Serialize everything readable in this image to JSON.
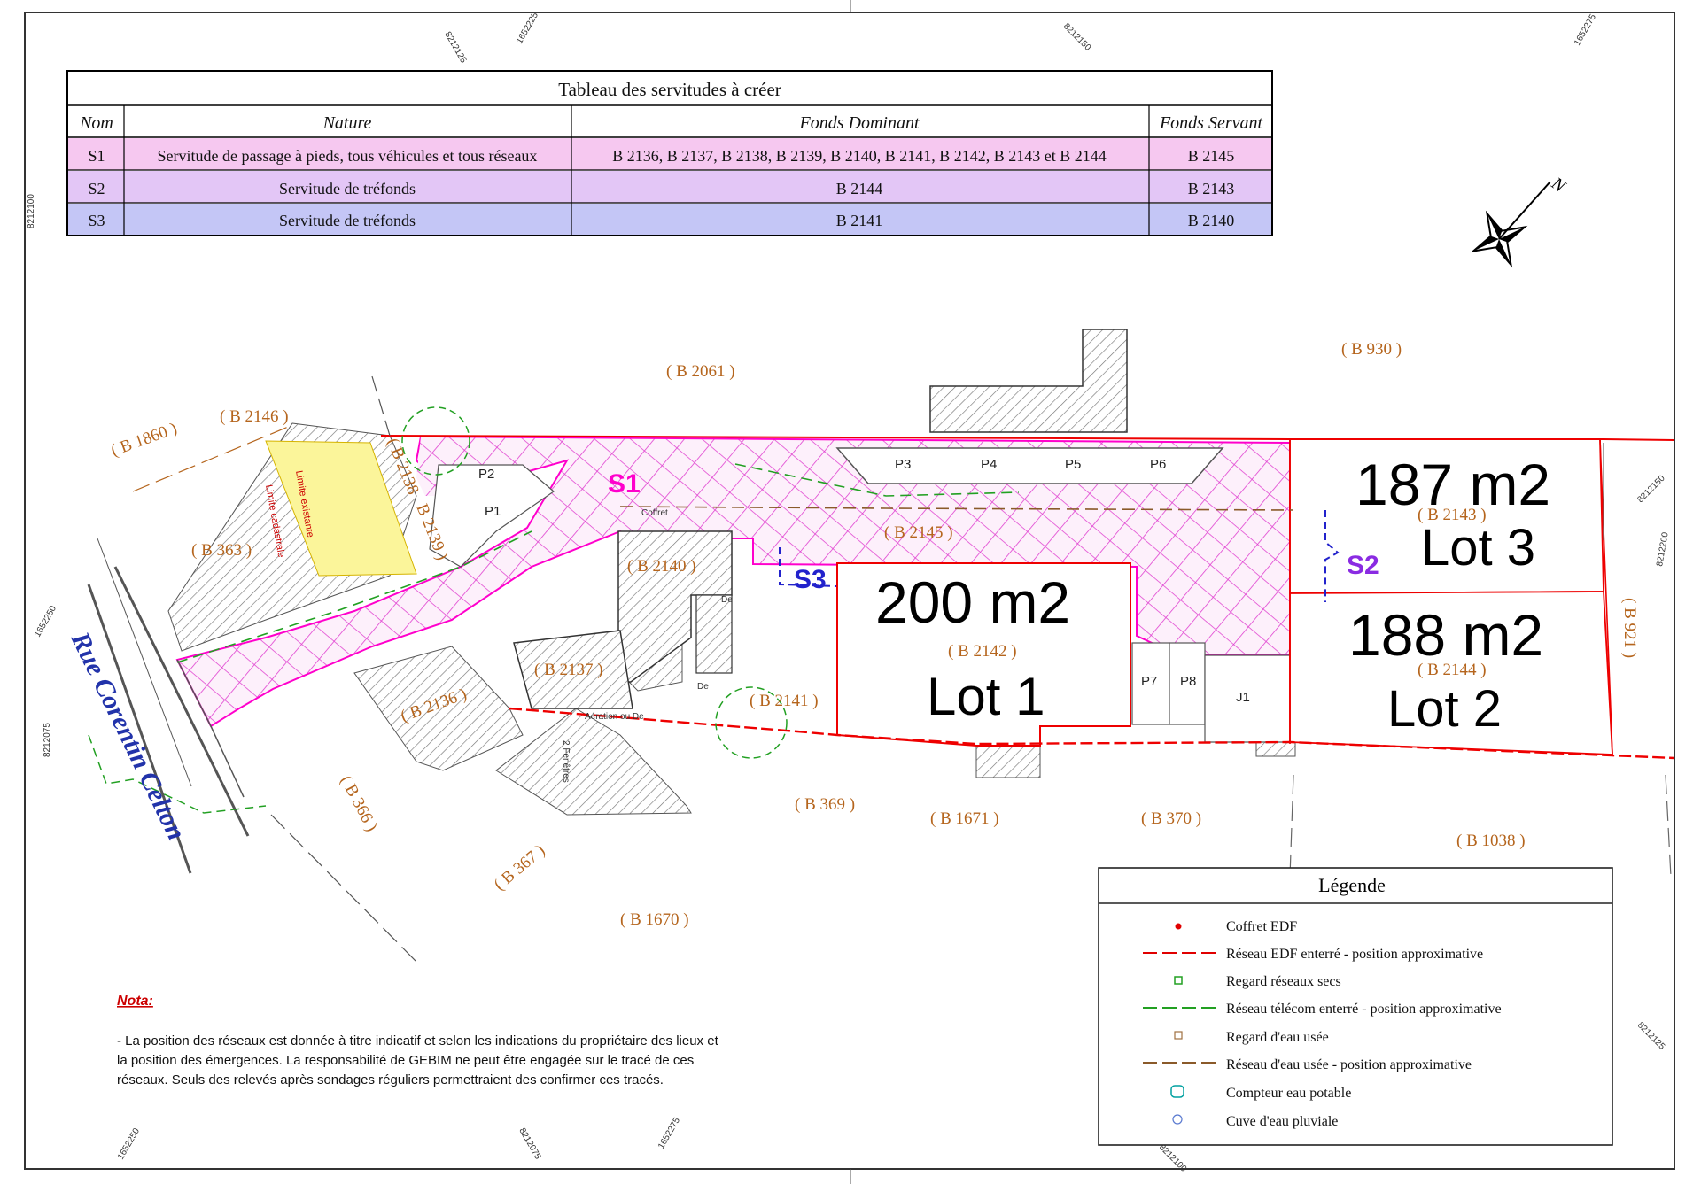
{
  "table": {
    "title": "Tableau des servitudes à créer",
    "headers": [
      "Nom",
      "Nature",
      "Fonds Dominant",
      "Fonds Servant"
    ],
    "rows": [
      {
        "nom": "S1",
        "nature": "Servitude de passage à pieds, tous véhicules et tous réseaux",
        "dominant": "B 2136, B 2137, B 2138, B 2139, B 2140, B 2141, B 2142, B 2143 et B 2144",
        "servant": "B 2145",
        "color": "#f6c8f0"
      },
      {
        "nom": "S2",
        "nature": "Servitude de tréfonds",
        "dominant": "B 2144",
        "servant": "B 2143",
        "color": "#e3c6f6"
      },
      {
        "nom": "S3",
        "nature": "Servitude de tréfonds",
        "dominant": "B 2141",
        "servant": "B 2140",
        "color": "#c4c6f6"
      }
    ]
  },
  "compass": {
    "north_label": "N"
  },
  "street": "Rue Corentin Celton",
  "parcels": [
    "( B 2061 )",
    "( B 930 )",
    "( B 1860 )",
    "( B 2146 )",
    "( B 363 )",
    "( B 2138",
    "B 2139 )",
    "( B 2140 )",
    "( B 2145 )",
    "( B 2142 )",
    "( B 2143 )",
    "( B 2144 )",
    "( B 921 )",
    "( B 2136 )",
    "( B 2137 )",
    "( B 2141 )",
    "( B 366 )",
    "( B 367 )",
    "( B 369 )",
    "( B 1671 )",
    "( B 370 )",
    "( B 1038 )",
    "( B 1670 )"
  ],
  "servitude_labels": {
    "s1": "S1",
    "s2": "S2",
    "s3": "S3"
  },
  "parking": [
    "P1",
    "P2",
    "P3",
    "P4",
    "P5",
    "P6",
    "P7",
    "P8",
    "J1"
  ],
  "lots": [
    {
      "area": "200 m2",
      "name": "Lot 1"
    },
    {
      "area": "188 m2",
      "name": "Lot 2"
    },
    {
      "area": "187 m2",
      "name": "Lot 3"
    }
  ],
  "small_labels": {
    "coffret_label": "Coffret",
    "aeration": "Aération ou De",
    "de1": "De",
    "de2": "De",
    "limite": "Limite existante",
    "fenetre": "2 Fenêtres",
    "ancienne_limite": "Limite cadastrale"
  },
  "coords": [
    "8212125",
    "1652225",
    "8212150",
    "1652275",
    "8212100",
    "8212150",
    "8212200",
    "1652250",
    "8212075",
    "1652250",
    "8212075",
    "1652275",
    "8212100",
    "8212125"
  ],
  "legend": {
    "title": "Légende",
    "items": [
      {
        "label": "Coffret EDF",
        "symbol": "edf-box",
        "color": "#e00000"
      },
      {
        "label": "Réseau EDF enterré - position approximative",
        "symbol": "dash-line",
        "color": "#e00000"
      },
      {
        "label": "Regard réseaux secs",
        "symbol": "square",
        "color": "#22a022"
      },
      {
        "label": "Réseau télécom enterré - position approximative",
        "symbol": "dash-line",
        "color": "#22a022"
      },
      {
        "label": "Regard d'eau usée",
        "symbol": "square",
        "color": "#a07040"
      },
      {
        "label": "Réseau d'eau usée - position approximative",
        "symbol": "dash-line",
        "color": "#8a5a2a"
      },
      {
        "label": "Compteur eau potable",
        "symbol": "meter",
        "color": "#00a0a0"
      },
      {
        "label": "Cuve d'eau pluviale",
        "symbol": "circle",
        "color": "#5a7ad0"
      }
    ]
  },
  "nota": {
    "title": "Nota:",
    "lines": [
      "- La position des réseaux est donnée à titre indicatif et selon les indications du propriétaire des lieux et",
      "la position des émergences. La responsabilité de GEBIM ne peut être engagée sur le tracé de ces",
      "réseaux. Seuls des relevés après sondages réguliers permettraient des confirmer ces tracés."
    ]
  }
}
